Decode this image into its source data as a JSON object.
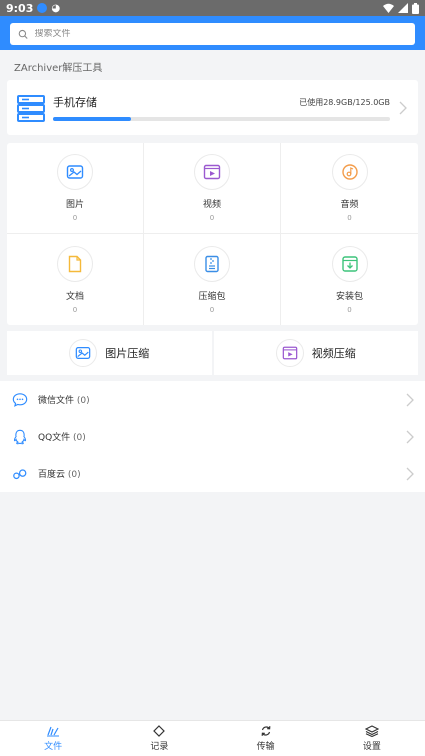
{
  "status_bar": {
    "time": "9:03"
  },
  "search": {
    "placeholder": "搜索文件"
  },
  "section": {
    "title": "ZArchiver解压工具"
  },
  "storage": {
    "name": "手机存储",
    "usage": "已使用28.9GB/125.0GB",
    "progress_percent": 23
  },
  "categories": [
    {
      "label": "图片",
      "count": "0",
      "icon": "image-icon",
      "color": "#2f8cff"
    },
    {
      "label": "视频",
      "count": "0",
      "icon": "video-icon",
      "color": "#9b59d0"
    },
    {
      "label": "音频",
      "count": "0",
      "icon": "music-icon",
      "color": "#f39c4a"
    },
    {
      "label": "文档",
      "count": "0",
      "icon": "document-icon",
      "color": "#f5b93a"
    },
    {
      "label": "压缩包",
      "count": "0",
      "icon": "archive-icon",
      "color": "#3a8ee6"
    },
    {
      "label": "安装包",
      "count": "0",
      "icon": "apk-icon",
      "color": "#3cc37a"
    }
  ],
  "compress": [
    {
      "label": "图片压缩",
      "icon": "image-compress-icon"
    },
    {
      "label": "视频压缩",
      "icon": "video-compress-icon"
    }
  ],
  "list": [
    {
      "label": "微信文件",
      "count": "(0)",
      "icon": "wechat-icon"
    },
    {
      "label": "QQ文件",
      "count": "(0)",
      "icon": "qq-icon"
    },
    {
      "label": "百度云",
      "count": "(0)",
      "icon": "baidu-cloud-icon"
    }
  ],
  "bottom_nav": [
    {
      "label": "文件",
      "icon": "files-icon",
      "active": true
    },
    {
      "label": "记录",
      "icon": "records-icon",
      "active": false
    },
    {
      "label": "传输",
      "icon": "transfer-icon",
      "active": false
    },
    {
      "label": "设置",
      "icon": "settings-icon",
      "active": false
    }
  ],
  "colors": {
    "accent": "#2f8cff",
    "background": "#f3f4f6"
  }
}
